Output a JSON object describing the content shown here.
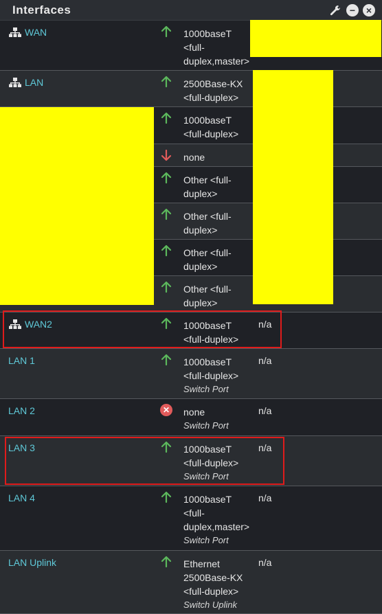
{
  "widget": {
    "title": "Interfaces",
    "icons": [
      "wrench-icon",
      "minimize-icon",
      "close-icon"
    ]
  },
  "rows": [
    {
      "name": "WAN",
      "icon": "network-icon",
      "status": "up",
      "media": [
        "1000baseT",
        "<full-",
        "duplex,master>"
      ],
      "sub": "",
      "ip": ""
    },
    {
      "name": "LAN",
      "icon": "network-icon",
      "status": "up",
      "media": [
        "2500Base-KX",
        "<full-duplex>"
      ],
      "sub": "",
      "ip": ""
    },
    {
      "name": "",
      "icon": "",
      "status": "up",
      "media": [
        "1000baseT",
        "<full-duplex>"
      ],
      "sub": "",
      "ip": ""
    },
    {
      "name": "",
      "icon": "",
      "status": "down",
      "media": [
        "none"
      ],
      "sub": "",
      "ip": ""
    },
    {
      "name": "",
      "icon": "",
      "status": "up",
      "media": [
        "Other <full-",
        "duplex>"
      ],
      "sub": "",
      "ip": ""
    },
    {
      "name": "",
      "icon": "",
      "status": "up",
      "media": [
        "Other <full-",
        "duplex>"
      ],
      "sub": "",
      "ip": ""
    },
    {
      "name": "",
      "icon": "",
      "status": "up",
      "media": [
        "Other <full-",
        "duplex>"
      ],
      "sub": "",
      "ip": ""
    },
    {
      "name": "",
      "icon": "",
      "status": "up",
      "media": [
        "Other <full-",
        "duplex>"
      ],
      "sub": "",
      "ip": ""
    },
    {
      "name": "WAN2",
      "icon": "network-icon",
      "status": "up",
      "media": [
        "1000baseT",
        "<full-duplex>"
      ],
      "sub": "",
      "ip": "n/a"
    },
    {
      "name": "LAN 1",
      "icon": "",
      "status": "up",
      "media": [
        "1000baseT",
        "<full-duplex>"
      ],
      "sub": "Switch Port",
      "ip": "n/a"
    },
    {
      "name": "LAN 2",
      "icon": "",
      "status": "no-carrier",
      "media": [
        "none"
      ],
      "sub": "Switch Port",
      "ip": "n/a"
    },
    {
      "name": "LAN 3",
      "icon": "",
      "status": "up",
      "media": [
        "1000baseT",
        "<full-duplex>"
      ],
      "sub": "Switch Port",
      "ip": "n/a"
    },
    {
      "name": "LAN 4",
      "icon": "",
      "status": "up",
      "media": [
        "1000baseT",
        "<full-",
        "duplex,master>"
      ],
      "sub": "Switch Port",
      "ip": "n/a"
    },
    {
      "name": "LAN Uplink",
      "icon": "",
      "status": "up",
      "media": [
        "Ethernet",
        "2500Base-KX",
        "<full-duplex>"
      ],
      "sub": "Switch Uplink",
      "ip": "n/a"
    }
  ],
  "colors": {
    "link": "#5fc9d8",
    "up": "#5cb85c",
    "down": "#e15b5b",
    "redaction": "#ffff00",
    "highlight": "#e01b1b"
  }
}
